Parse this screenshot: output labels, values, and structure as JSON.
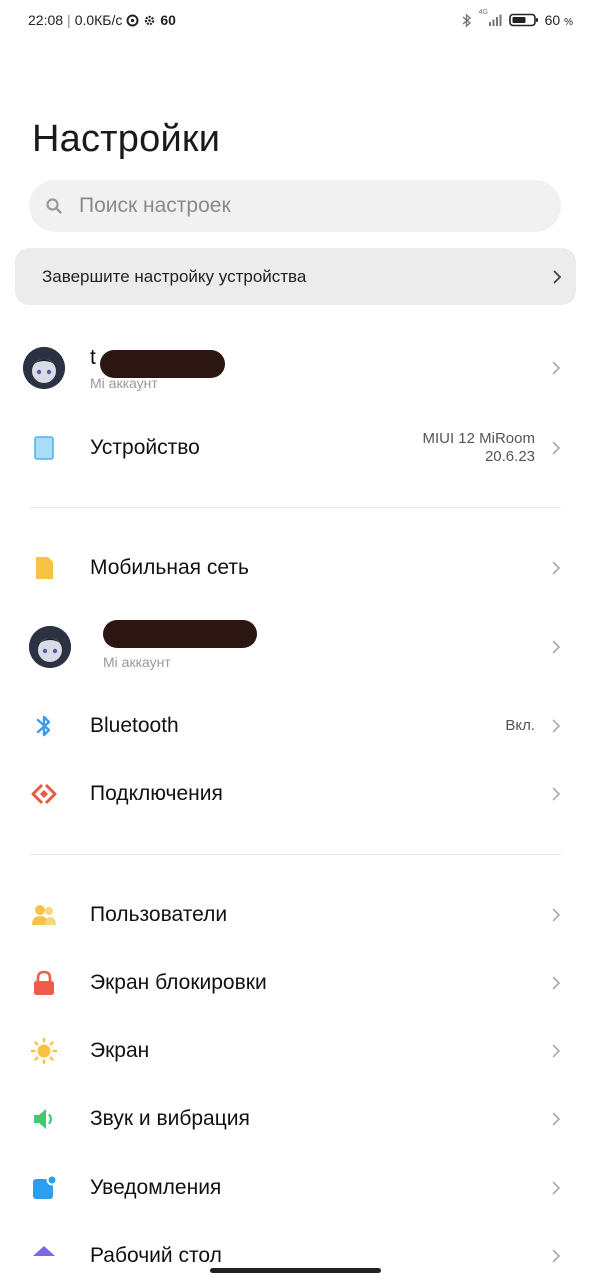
{
  "status": {
    "time": "22:08",
    "speed": "0.0КБ/с",
    "icon_count": "60",
    "network": "4G",
    "battery": "60",
    "battery_unit": "%"
  },
  "header": {
    "title": "Настройки"
  },
  "search": {
    "placeholder": "Поиск настроек"
  },
  "banner": {
    "label": "Завершите настройку устройства"
  },
  "account": {
    "name_visible": "t",
    "sub": "Mi аккаунт"
  },
  "device": {
    "label": "Устройство",
    "value_line1": "MIUI 12 MiRoom",
    "value_line2": "20.6.23"
  },
  "items": [
    {
      "label": "Мобильная сеть",
      "icon": "sim-card-icon",
      "color": "#f6c344"
    },
    {
      "label": "",
      "sub": "Mi аккаунт",
      "icon": "avatar"
    },
    {
      "label": "Bluetooth",
      "value": "Вкл.",
      "icon": "bluetooth-icon",
      "color": "#3d9be9"
    },
    {
      "label": "Подключения",
      "icon": "connections-icon",
      "color": "#e65a40"
    },
    {
      "label": "Пользователи",
      "icon": "users-icon",
      "color": "#f6c344"
    },
    {
      "label": "Экран блокировки",
      "icon": "lock-icon",
      "color": "#ee5b4b"
    },
    {
      "label": "Экран",
      "icon": "sun-icon",
      "color": "#f6c344"
    },
    {
      "label": "Звук и вибрация",
      "icon": "speaker-icon",
      "color": "#3fca72"
    },
    {
      "label": "Уведомления",
      "icon": "notification-icon",
      "color": "#2b9ef0"
    },
    {
      "label": "Рабочий стол",
      "icon": "home-icon",
      "color": "#7b68e8"
    }
  ]
}
